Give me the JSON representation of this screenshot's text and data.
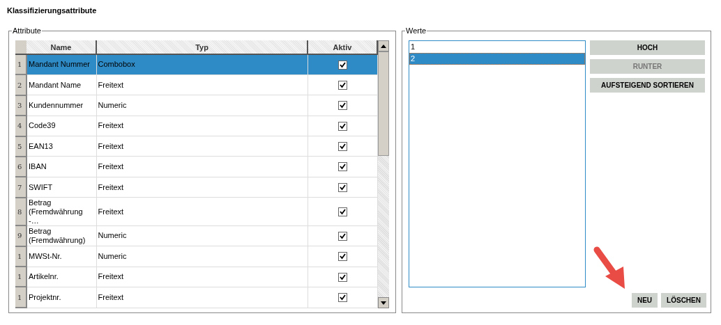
{
  "title": "Klassifizierungsattribute",
  "attributes": {
    "legend": "Attribute",
    "columns": [
      "Name",
      "Typ",
      "Aktiv"
    ],
    "rows": [
      {
        "number": "1",
        "name": "Mandant Nummer",
        "type": "Combobox",
        "active": true,
        "selected": true
      },
      {
        "number": "2",
        "name": "Mandant Name",
        "type": "Freitext",
        "active": true,
        "selected": false
      },
      {
        "number": "3",
        "name": "Kundennummer",
        "type": "Numeric",
        "active": true,
        "selected": false
      },
      {
        "number": "4",
        "name": "Code39",
        "type": "Freitext",
        "active": true,
        "selected": false
      },
      {
        "number": "5",
        "name": "EAN13",
        "type": "Freitext",
        "active": true,
        "selected": false
      },
      {
        "number": "6",
        "name": "IBAN",
        "type": "Freitext",
        "active": true,
        "selected": false
      },
      {
        "number": "7",
        "name": "SWIFT",
        "type": "Freitext",
        "active": true,
        "selected": false
      },
      {
        "number": "8",
        "name": "Betrag (Fremdwährung -…",
        "type": "Freitext",
        "active": true,
        "selected": false
      },
      {
        "number": "9",
        "name": "Betrag (Fremdwährung)",
        "type": "Numeric",
        "active": true,
        "selected": false
      },
      {
        "number": "1",
        "name": "MWSt-Nr.",
        "type": "Numeric",
        "active": true,
        "selected": false
      },
      {
        "number": "1",
        "name": "Artikelnr.",
        "type": "Freitext",
        "active": true,
        "selected": false
      },
      {
        "number": "1",
        "name": "Projektnr.",
        "type": "Freitext",
        "active": true,
        "selected": false
      }
    ]
  },
  "values": {
    "legend": "Werte",
    "items": [
      {
        "label": "1",
        "selected": false
      },
      {
        "label": "2",
        "selected": true
      }
    ],
    "side_buttons": [
      {
        "label": "HOCH",
        "disabled": false
      },
      {
        "label": "RUNTER",
        "disabled": true
      },
      {
        "label": "AUFSTEIGEND SORTIEREN",
        "disabled": false
      }
    ],
    "bottom_buttons": [
      {
        "label": "NEU",
        "disabled": false
      },
      {
        "label": "LÖSCHEN",
        "disabled": false
      }
    ]
  }
}
